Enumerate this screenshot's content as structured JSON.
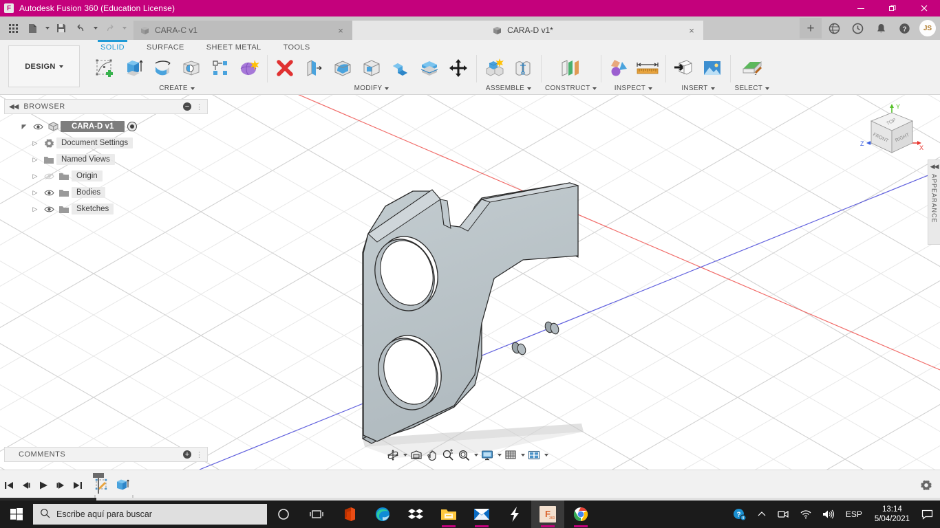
{
  "titlebar": {
    "app_title": "Autodesk Fusion 360 (Education License)",
    "logo_letter": "F",
    "minimize": "minimize-icon",
    "maximize": "maximize-icon",
    "close": "close-icon",
    "bg_color": "#c4017c"
  },
  "quick_access": {
    "buttons": [
      {
        "name": "show-data-panel",
        "icon": "grid-icon"
      },
      {
        "name": "file-menu",
        "icon": "file-icon",
        "has_caret": true
      },
      {
        "name": "save",
        "icon": "save-icon"
      },
      {
        "name": "undo",
        "icon": "undo-icon",
        "has_caret": true
      },
      {
        "name": "redo",
        "icon": "redo-icon",
        "has_caret": true
      }
    ],
    "tabs": [
      {
        "label": "CARA-C v1",
        "active": false,
        "closable": true,
        "close_label": "×"
      },
      {
        "label": "CARA-D v1*",
        "active": true,
        "closable": true,
        "close_label": "×"
      }
    ],
    "new_tab_label": "+",
    "right_icons": [
      {
        "name": "extensions-icon",
        "glyph": "globe"
      },
      {
        "name": "recent-activity-icon",
        "glyph": "clock"
      },
      {
        "name": "notifications-icon",
        "glyph": "bell"
      },
      {
        "name": "help-icon",
        "glyph": "question"
      }
    ],
    "avatar_initials": "JS"
  },
  "ribbon": {
    "workspace_label": "DESIGN",
    "tabs": [
      {
        "label": "SOLID",
        "active": true
      },
      {
        "label": "SURFACE",
        "active": false
      },
      {
        "label": "SHEET METAL",
        "active": false
      },
      {
        "label": "TOOLS",
        "active": false
      }
    ],
    "active_tab_color": "#1e9ad6",
    "groups": [
      {
        "label": "CREATE",
        "has_caret": true,
        "tools": [
          {
            "name": "create-sketch-tool",
            "icon": "sketch-plus-icon"
          },
          {
            "name": "extrude-tool",
            "icon": "extrude-icon"
          },
          {
            "name": "revolve-tool",
            "icon": "revolve-icon"
          },
          {
            "name": "hole-tool",
            "icon": "hole-icon"
          },
          {
            "name": "pattern-tool",
            "icon": "pattern-icon"
          },
          {
            "name": "form-tool",
            "icon": "form-icon"
          }
        ]
      },
      {
        "label": "MODIFY",
        "has_caret": true,
        "tools": [
          {
            "name": "press-pull-tool",
            "icon": "red-x-icon"
          },
          {
            "name": "offset-face-tool",
            "icon": "offset-face-icon"
          },
          {
            "name": "fillet-tool",
            "icon": "fillet-icon"
          },
          {
            "name": "shell-tool",
            "icon": "shell-icon"
          },
          {
            "name": "combine-tool",
            "icon": "combine-icon"
          },
          {
            "name": "split-face-tool",
            "icon": "split-face-icon"
          },
          {
            "name": "move-copy-tool",
            "icon": "move-arrows-icon"
          }
        ]
      },
      {
        "label": "ASSEMBLE",
        "has_caret": true,
        "tools": [
          {
            "name": "new-component-tool",
            "icon": "new-component-icon"
          },
          {
            "name": "joint-tool",
            "icon": "joint-icon"
          }
        ]
      },
      {
        "label": "CONSTRUCT",
        "has_caret": true,
        "tools": [
          {
            "name": "offset-plane-tool",
            "icon": "offset-plane-icon"
          }
        ]
      },
      {
        "label": "INSPECT",
        "has_caret": true,
        "tools": [
          {
            "name": "measure-tool",
            "icon": "inspect-shapes-icon"
          },
          {
            "name": "measure-ruler-tool",
            "icon": "ruler-icon"
          }
        ]
      },
      {
        "label": "INSERT",
        "has_caret": true,
        "tools": [
          {
            "name": "insert-derive-tool",
            "icon": "insert-derive-icon"
          },
          {
            "name": "insert-canvas-tool",
            "icon": "image-icon"
          }
        ]
      },
      {
        "label": "SELECT",
        "has_caret": true,
        "tools": [
          {
            "name": "select-tool",
            "icon": "select-paint-icon"
          }
        ]
      }
    ]
  },
  "browser": {
    "panel_title": "BROWSER",
    "collapse_icon": "collapse-left-icon",
    "action_icon": "minus-circle-icon",
    "tree": [
      {
        "label": "CARA-D v1",
        "level": 0,
        "root": true,
        "expanded": true,
        "visible": true,
        "icon": "component-icon"
      },
      {
        "label": "Document Settings",
        "level": 1,
        "root": false,
        "expanded": false,
        "visible": null,
        "icon": "gear-icon"
      },
      {
        "label": "Named Views",
        "level": 1,
        "root": false,
        "expanded": false,
        "visible": null,
        "icon": "folder-icon"
      },
      {
        "label": "Origin",
        "level": 1,
        "root": false,
        "expanded": false,
        "visible": false,
        "icon": "folder-icon"
      },
      {
        "label": "Bodies",
        "level": 1,
        "root": false,
        "expanded": false,
        "visible": true,
        "icon": "folder-icon"
      },
      {
        "label": "Sketches",
        "level": 1,
        "root": false,
        "expanded": false,
        "visible": true,
        "icon": "folder-icon"
      }
    ]
  },
  "comments": {
    "panel_title": "COMMENTS",
    "action_icon": "plus-circle-icon"
  },
  "viewcube": {
    "faces": [
      "TOP",
      "FRONT",
      "RIGHT"
    ],
    "axes": [
      {
        "label": "X",
        "color": "#e8352e"
      },
      {
        "label": "Y",
        "color": "#57c12a"
      },
      {
        "label": "Z",
        "color": "#3a5fe0"
      }
    ]
  },
  "appearance_panel": {
    "label": "APPEARANCE",
    "collapse_icon": "collapse-icon"
  },
  "navbar": {
    "buttons": [
      {
        "name": "orbit-button",
        "icon": "orbit-icon",
        "has_caret": true
      },
      {
        "name": "look-at-button",
        "icon": "look-at-icon",
        "has_caret": false
      },
      {
        "name": "pan-button",
        "icon": "pan-hand-icon",
        "has_caret": false
      },
      {
        "name": "zoom-button",
        "icon": "zoom-icon",
        "has_caret": false
      },
      {
        "name": "fit-button",
        "icon": "fit-icon",
        "has_caret": true
      },
      {
        "name": "display-settings-button",
        "icon": "display-monitor-icon",
        "has_caret": true
      },
      {
        "name": "grid-snaps-button",
        "icon": "grid-icon",
        "has_caret": true
      },
      {
        "name": "viewports-button",
        "icon": "viewports-icon",
        "has_caret": true
      }
    ]
  },
  "timeline": {
    "playback": [
      {
        "name": "go-to-beginning-button",
        "icon": "skip-start-icon"
      },
      {
        "name": "step-back-button",
        "icon": "step-back-icon"
      },
      {
        "name": "play-button",
        "icon": "play-icon"
      },
      {
        "name": "step-forward-button",
        "icon": "step-forward-icon"
      },
      {
        "name": "go-to-end-button",
        "icon": "skip-end-icon"
      }
    ],
    "features": [
      {
        "name": "timeline-feature-sketch",
        "icon": "sketch-icon"
      },
      {
        "name": "timeline-feature-extrude",
        "icon": "extrude-icon"
      }
    ],
    "settings_icon": "gear-icon"
  },
  "canvas": {
    "model_name": "bracket-plate-body",
    "model_fill": "#b9c2c6",
    "model_edge": "#2b2b2b",
    "axis_x_color": "#ef5350",
    "axis_z_color": "#3a3ad6",
    "grid_color": "#e2e2e2",
    "shadow_color": "#c9c9c9"
  },
  "taskbar": {
    "start_icon": "windows-start-icon",
    "search_placeholder": "Escribe aquí para buscar",
    "search_icon": "search-icon",
    "buttons": [
      {
        "name": "taskview-cortana-button",
        "icon": "cortana-circle-icon"
      },
      {
        "name": "task-view-button",
        "icon": "task-view-icon"
      }
    ],
    "apps": [
      {
        "name": "taskbar-app-office",
        "icon": "office-icon",
        "running": false,
        "active": false
      },
      {
        "name": "taskbar-app-edge",
        "icon": "edge-icon",
        "running": false,
        "active": false
      },
      {
        "name": "taskbar-app-dropbox",
        "icon": "dropbox-icon",
        "running": false,
        "active": false
      },
      {
        "name": "taskbar-app-explorer",
        "icon": "folder-icon",
        "running": true,
        "active": false
      },
      {
        "name": "taskbar-app-mail",
        "icon": "mail-icon",
        "running": true,
        "active": false
      },
      {
        "name": "taskbar-app-snagit",
        "icon": "snagit-icon",
        "running": false,
        "active": false
      },
      {
        "name": "taskbar-app-fusion360",
        "icon": "fusion-icon",
        "running": true,
        "active": true
      },
      {
        "name": "taskbar-app-chrome",
        "icon": "chrome-icon",
        "running": true,
        "active": false
      }
    ],
    "tray": {
      "help_icon": "question-bubble-icon",
      "chevron_icon": "chevron-up-icon",
      "camera_icon": "camera-icon",
      "wifi_icon": "wifi-icon",
      "volume_icon": "volume-icon",
      "language": "ESP",
      "time": "13:14",
      "date": "5/04/2021",
      "notifications_icon": "notification-icon"
    }
  }
}
